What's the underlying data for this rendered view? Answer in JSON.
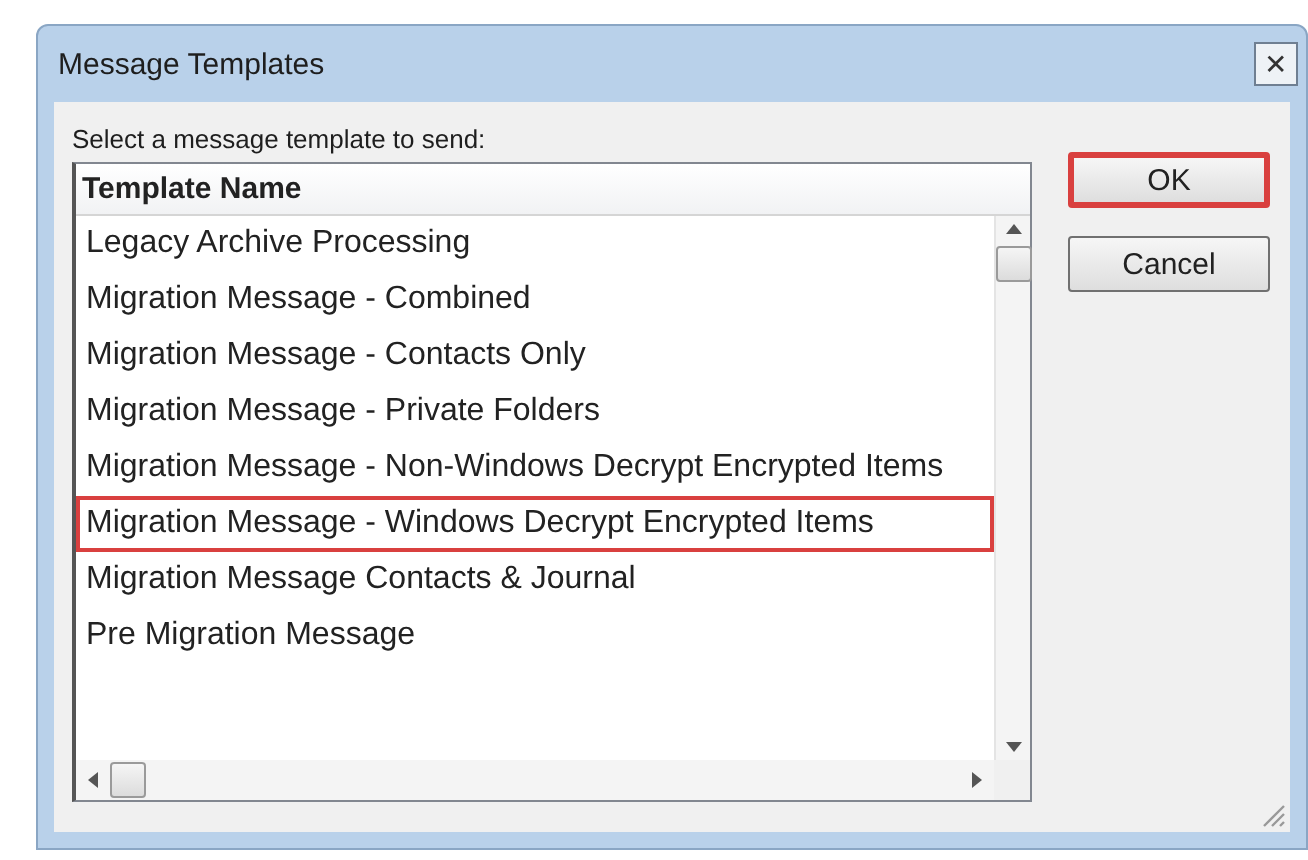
{
  "window": {
    "title": "Message Templates",
    "close_glyph": "✕"
  },
  "prompt": "Select a message template to send:",
  "table": {
    "columns": [
      "Template Name"
    ],
    "rows": [
      {
        "name": "Legacy Archive Processing",
        "selected": false
      },
      {
        "name": "Migration Message - Combined",
        "selected": false
      },
      {
        "name": "Migration Message - Contacts Only",
        "selected": false
      },
      {
        "name": "Migration Message - Private Folders",
        "selected": false
      },
      {
        "name": "Migration Message - Non-Windows Decrypt Encrypted Items",
        "selected": false
      },
      {
        "name": "Migration Message - Windows Decrypt Encrypted Items",
        "selected": true
      },
      {
        "name": "Migration Message Contacts & Journal",
        "selected": false
      },
      {
        "name": "Pre Migration Message",
        "selected": false
      }
    ]
  },
  "buttons": [
    {
      "label": "OK",
      "highlighted": true
    },
    {
      "label": "Cancel",
      "highlighted": false
    }
  ]
}
